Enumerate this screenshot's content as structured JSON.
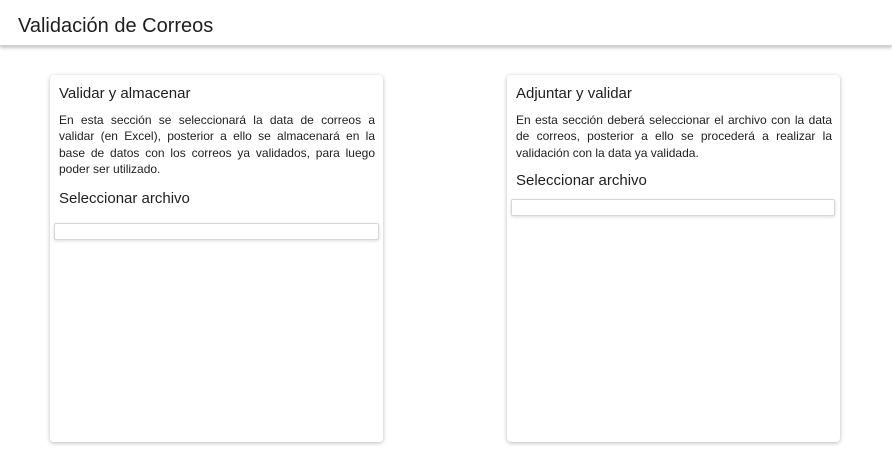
{
  "header": {
    "title": "Validación de Correos"
  },
  "cards": [
    {
      "title": "Validar y almacenar",
      "description": "En esta sección se seleccionará la data de correos a validar (en Excel), posterior a ello se almacenará en la base de datos con los correos ya validados, para luego poder ser utilizado.",
      "select_label": "Seleccionar archivo",
      "file_input_value": ""
    },
    {
      "title": "Adjuntar y validar",
      "description": "En esta sección deberá seleccionar el archivo con la data de correos, posterior a ello se procederá a realizar la validación con la data ya validada.",
      "select_label": "Seleccionar archivo",
      "file_input_value": ""
    }
  ]
}
